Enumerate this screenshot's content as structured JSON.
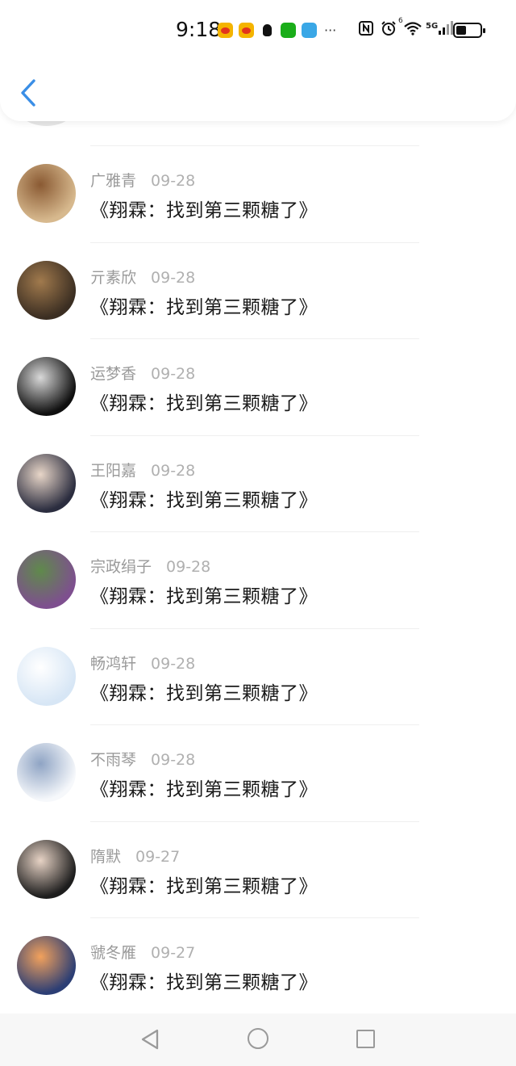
{
  "status_bar": {
    "time": "9:18",
    "notification_icons": [
      "weibo-icon",
      "weibo-icon",
      "qq-icon",
      "wechat-icon",
      "app-icon"
    ],
    "more": "···",
    "system_icons": [
      "nfc-icon",
      "alarm-icon",
      "wifi-icon",
      "signal-5g-icon",
      "battery-icon"
    ],
    "signal_label": "5G",
    "wifi_label": "6"
  },
  "header": {
    "back_icon": "chevron-left-icon",
    "accent_color": "#3a8ee6"
  },
  "comments": [
    {
      "user": "广雅青",
      "date": "09-28",
      "text": "《翔霖：找到第三颗糖了》",
      "avatar_colors": [
        "#d7b98e",
        "#8a5a33"
      ]
    },
    {
      "user": "亓素欣",
      "date": "09-28",
      "text": "《翔霖：找到第三颗糖了》",
      "avatar_colors": [
        "#3b2e22",
        "#a17a4d"
      ]
    },
    {
      "user": "运梦香",
      "date": "09-28",
      "text": "《翔霖：找到第三颗糖了》",
      "avatar_colors": [
        "#0f0f0f",
        "#d9d9d9"
      ]
    },
    {
      "user": "王阳嘉",
      "date": "09-28",
      "text": "《翔霖：找到第三颗糖了》",
      "avatar_colors": [
        "#2b2d3f",
        "#e8d6c8"
      ]
    },
    {
      "user": "宗政绢子",
      "date": "09-28",
      "text": "《翔霖：找到第三颗糖了》",
      "avatar_colors": [
        "#7e4f8f",
        "#5f8a4b"
      ]
    },
    {
      "user": "畅鸿轩",
      "date": "09-28",
      "text": "《翔霖：找到第三颗糖了》",
      "avatar_colors": [
        "#d7e6f5",
        "#ffffff"
      ]
    },
    {
      "user": "不雨琴",
      "date": "09-28",
      "text": "《翔霖：找到第三颗糖了》",
      "avatar_colors": [
        "#f6f8fb",
        "#8fa4c4"
      ]
    },
    {
      "user": "隋默",
      "date": "09-27",
      "text": "《翔霖：找到第三颗糖了》",
      "avatar_colors": [
        "#1d1d1d",
        "#e7d3c5"
      ]
    },
    {
      "user": "虢冬雁",
      "date": "09-27",
      "text": "《翔霖：找到第三颗糖了》",
      "avatar_colors": [
        "#2c3e74",
        "#f2a15c"
      ]
    }
  ],
  "nav": {
    "back_icon": "triangle-back-icon",
    "home_icon": "circle-home-icon",
    "recent_icon": "square-recent-icon"
  }
}
